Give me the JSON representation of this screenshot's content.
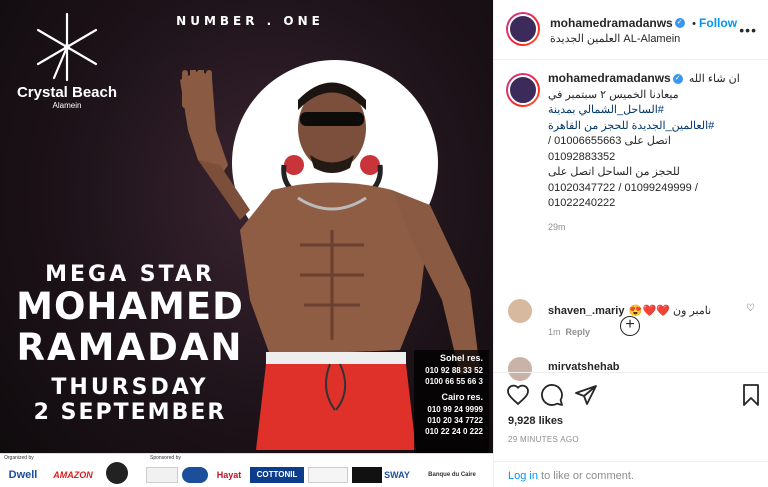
{
  "poster": {
    "headline": "NUMBER . ONE",
    "brand_name": "Crystal Beach",
    "brand_sub": "Alamein",
    "event_line1": "MEGA STAR",
    "event_line2": "MOHAMED",
    "event_line3": "RAMADAN",
    "event_line4": "THURSDAY",
    "event_line5": "2 SEPTEMBER",
    "sohel_title": "Sohel res.",
    "sohel_numbers": [
      "010 92 88 33 52",
      "0100 66 55 66 3"
    ],
    "cairo_title": "Cairo res.",
    "cairo_numbers": [
      "010 99 24 9999",
      "010 20 34 7722",
      "010 22 24 0 222"
    ],
    "organized_label": "Organized by",
    "sponsored_label": "Sponsored by",
    "logos": [
      "Dwell",
      "AMAZON",
      "Hayat",
      "COTTONIL",
      "SWAY",
      "Banque du Caire"
    ]
  },
  "header": {
    "username": "mohamedramadanws",
    "verified": "✓",
    "separator": "•",
    "follow_label": "Follow",
    "location": "العلمين الجديدة AL-Alamein",
    "more": "•••"
  },
  "caption": {
    "username": "mohamedramadanws",
    "lines": [
      "ان شاء الله",
      "ميعادنا الخميس ٢ سبتمبر في",
      "#الساحل_الشمالي بمدينة",
      "#العالمين_الجديدة للحجز من القاهرة",
      "اتصل على 01006655663 /",
      "01092883352",
      "للحجز من الساحل اتصل على",
      "01020347722 / 01099249999 /",
      "01022240222"
    ],
    "time": "29m",
    "load_more": "+"
  },
  "comments": [
    {
      "username": "shaven_.mariy",
      "text": "نامبر ون ❤️❤️😍",
      "time": "1m",
      "reply_label": "Reply"
    },
    {
      "username": "mirvatshehab",
      "text": ""
    }
  ],
  "actions": {
    "likes": "9,928 likes",
    "posted_ago": "29 MINUTES AGO",
    "login_link": "Log in",
    "login_rest": " to like or comment."
  },
  "colors": {
    "accent": "#0095f6",
    "verified": "#3897f0",
    "heart": "#ed4956",
    "poster_shorts": "#e0302a"
  }
}
